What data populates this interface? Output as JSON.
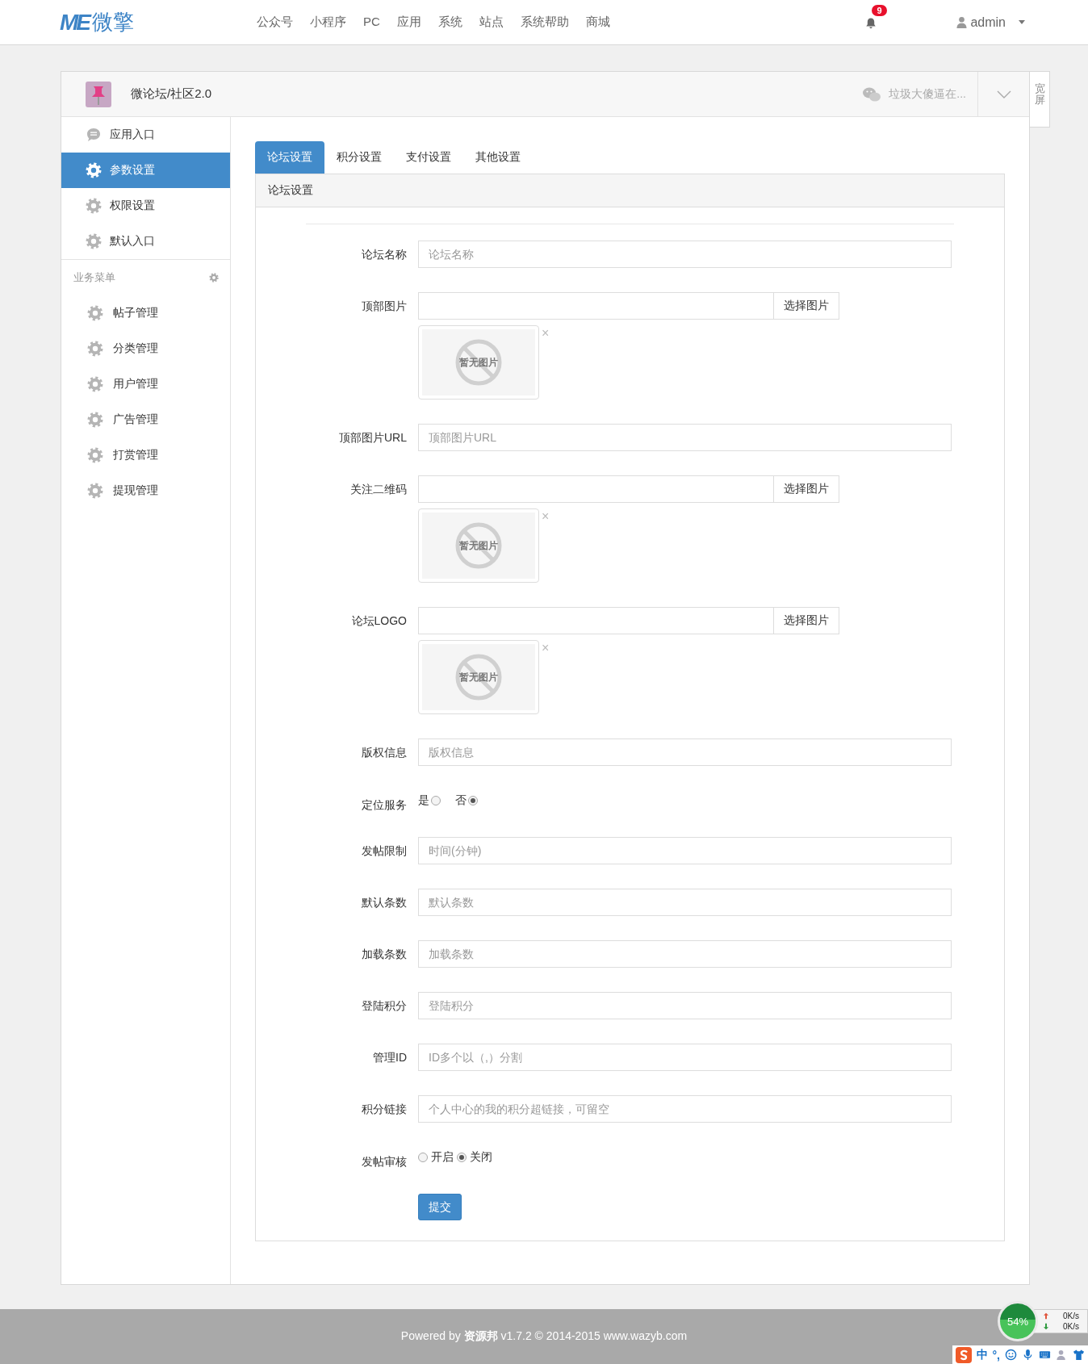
{
  "header": {
    "logo_mark": "ME",
    "logo_text": "微擎",
    "nav": [
      {
        "label": "公众号"
      },
      {
        "label": "小程序"
      },
      {
        "label": "PC"
      },
      {
        "label": "应用"
      },
      {
        "label": "系统"
      },
      {
        "label": "站点"
      },
      {
        "label": "系统帮助"
      },
      {
        "label": "商城"
      }
    ],
    "notifications": "9",
    "user": "admin"
  },
  "app": {
    "title": "微论坛/社区2.0",
    "account": "垃圾大傻逼在...",
    "side_tab": "宽屏"
  },
  "sidebar": {
    "items": [
      {
        "label": "应用入口",
        "kind": "chat",
        "selected": false
      },
      {
        "label": "参数设置",
        "kind": "gear",
        "selected": true
      },
      {
        "label": "权限设置",
        "kind": "gear",
        "selected": false
      },
      {
        "label": "默认入口",
        "kind": "gear",
        "selected": false
      }
    ],
    "section": "业务菜单",
    "menu": [
      {
        "label": "帖子管理",
        "selected": false
      },
      {
        "label": "分类管理",
        "selected": false
      },
      {
        "label": "用户管理",
        "selected": false
      },
      {
        "label": "广告管理",
        "selected": false
      },
      {
        "label": "打赏管理",
        "selected": false
      },
      {
        "label": "提现管理",
        "selected": false
      }
    ]
  },
  "tabs": [
    {
      "label": "论坛设置",
      "selected": true
    },
    {
      "label": "积分设置",
      "selected": false
    },
    {
      "label": "支付设置",
      "selected": false
    },
    {
      "label": "其他设置",
      "selected": false
    }
  ],
  "card": {
    "title": "论坛设置",
    "fields": [
      {
        "kind": "text",
        "label": "论坛名称",
        "placeholder": "论坛名称"
      },
      {
        "kind": "image",
        "label": "顶部图片",
        "button": "选择图片",
        "preview_text": "暂无图片",
        "remove": "×"
      },
      {
        "kind": "text",
        "label": "顶部图片URL",
        "placeholder": "顶部图片URL"
      },
      {
        "kind": "image",
        "label": "关注二维码",
        "button": "选择图片",
        "preview_text": "暂无图片",
        "remove": "×"
      },
      {
        "kind": "image",
        "label": "论坛LOGO",
        "button": "选择图片",
        "preview_text": "暂无图片",
        "remove": "×"
      },
      {
        "kind": "text",
        "label": "版权信息",
        "placeholder": "版权信息"
      },
      {
        "kind": "radio_label_first",
        "label": "定位服务",
        "options": [
          {
            "label": "是",
            "selected": false
          },
          {
            "label": "否",
            "selected": true
          }
        ]
      },
      {
        "kind": "text",
        "label": "发帖限制",
        "placeholder": "时间(分钟)"
      },
      {
        "kind": "text",
        "label": "默认条数",
        "placeholder": "默认条数"
      },
      {
        "kind": "text",
        "label": "加载条数",
        "placeholder": "加载条数"
      },
      {
        "kind": "text",
        "label": "登陆积分",
        "placeholder": "登陆积分"
      },
      {
        "kind": "text",
        "label": "管理ID",
        "placeholder": "ID多个以（,）分割"
      },
      {
        "kind": "text",
        "label": "积分链接",
        "placeholder": "个人中心的我的积分超链接，可留空"
      },
      {
        "kind": "radio",
        "label": "发帖审核",
        "options": [
          {
            "label": "开启",
            "selected": false
          },
          {
            "label": "关闭",
            "selected": true
          }
        ]
      }
    ],
    "submit": "提交"
  },
  "footer": "Powered by **资源邦** v1.7.2 © 2014-2015 www.wazyb.com",
  "net_meter": {
    "percent": "54%",
    "up": "0K/s",
    "down": "0K/s"
  },
  "ime_bar": {
    "mode": "中",
    "punct": "°,"
  }
}
